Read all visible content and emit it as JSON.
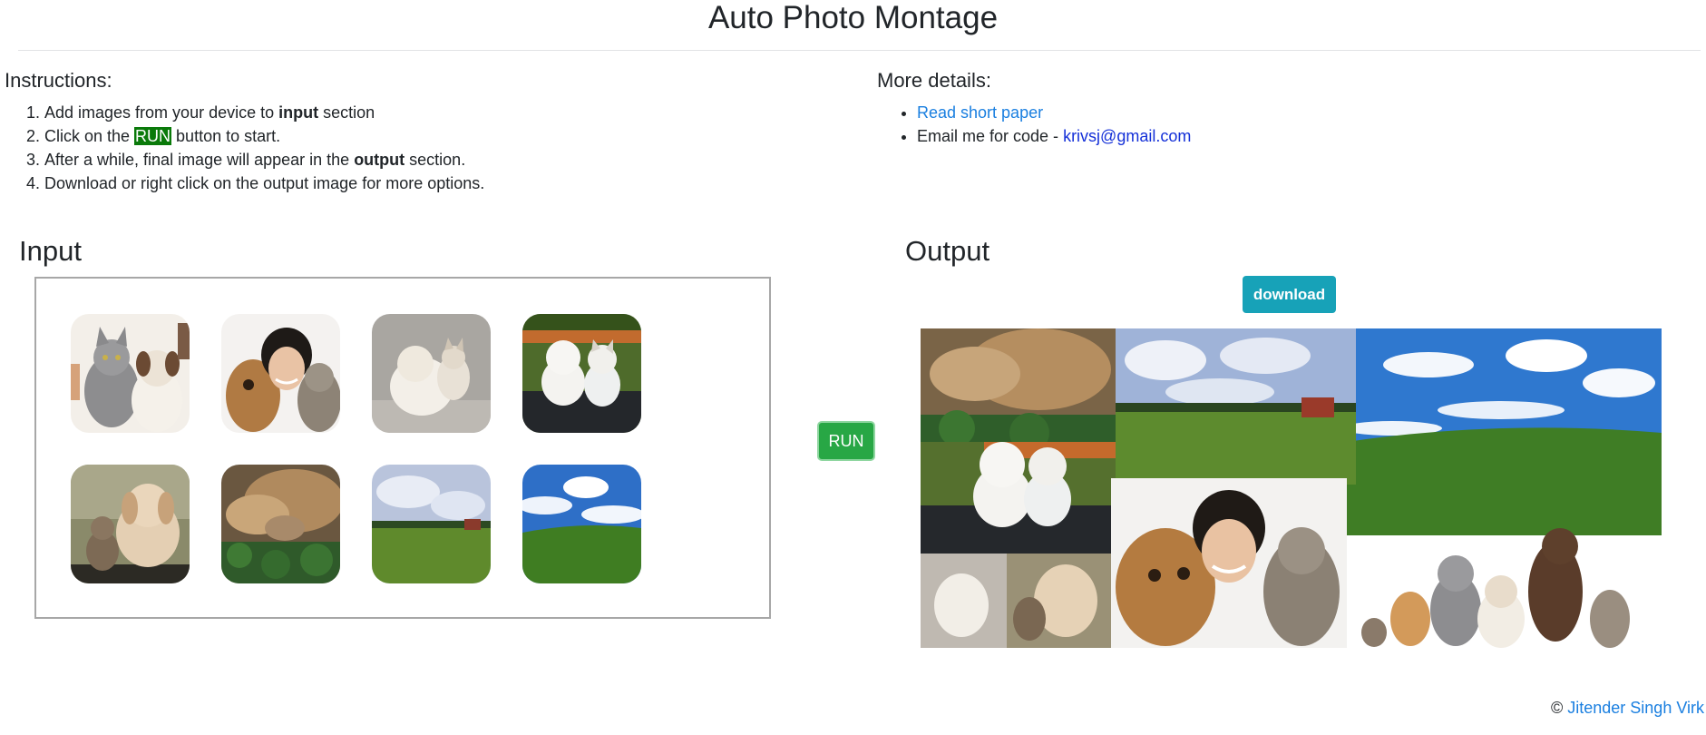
{
  "title": "Auto Photo Montage",
  "instructions": {
    "heading": "Instructions:",
    "step1": {
      "pre": "Add images from your device to ",
      "bold": "input",
      "post": " section"
    },
    "step2": {
      "pre": "Click on the ",
      "highlight": "RUN",
      "post": " button to start."
    },
    "step3": {
      "pre": "After a while, final image will appear in the ",
      "bold": "output",
      "post": " section."
    },
    "step4": {
      "text": "Download or right click on the output image for more options."
    }
  },
  "details": {
    "heading": "More details:",
    "paper_link": "Read short paper",
    "email_prefix": "Email me for code - ",
    "email": "krivsj@gmail.com"
  },
  "input": {
    "heading": "Input",
    "thumbnails": [
      "cat-and-puppy-image",
      "woman-with-dog-and-cat-image",
      "white-puppy-and-kitten-image",
      "puppy-and-kitten-on-bench-image",
      "puppy-and-kitten-on-rocks-image",
      "sleeping-cat-and-dog-image",
      "green-field-with-barn-image",
      "green-hill-blue-sky-image"
    ]
  },
  "run_label": "RUN",
  "output": {
    "heading": "Output",
    "download_label": "download"
  },
  "footer": {
    "symbol": "©",
    "author": "Jitender Singh Virk"
  },
  "colors": {
    "run_button": "#28a745",
    "download_button": "#17a2b8",
    "link": "#1a7fe0",
    "highlight": "#0a7a0a"
  }
}
